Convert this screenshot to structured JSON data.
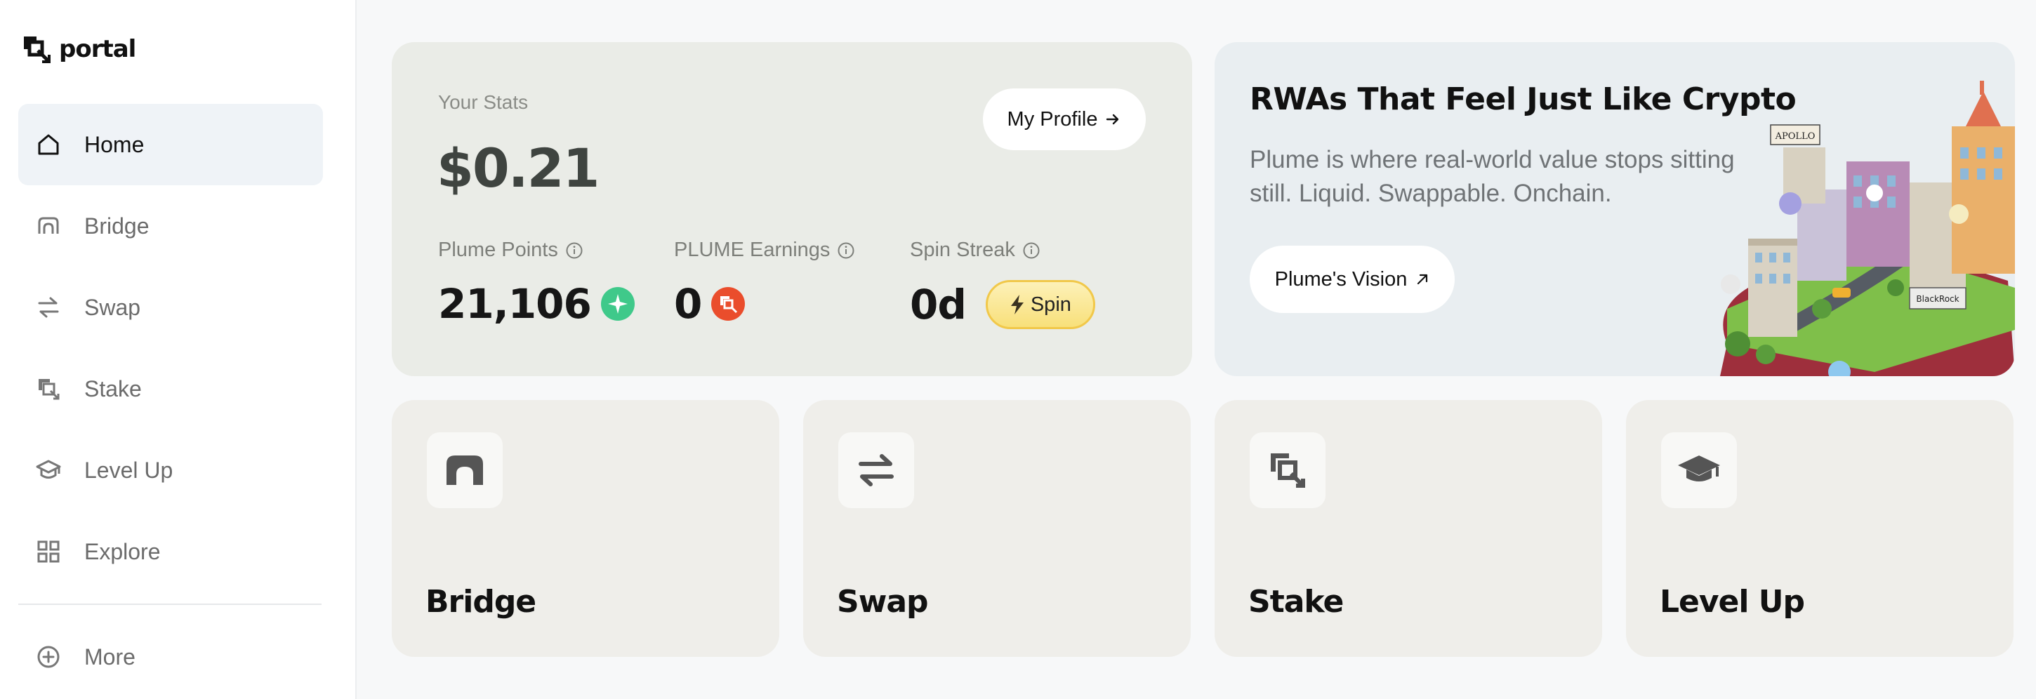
{
  "app": {
    "logo_text": "portal"
  },
  "sidebar": {
    "items": [
      {
        "label": "Home",
        "icon": "home-icon",
        "active": true
      },
      {
        "label": "Bridge",
        "icon": "bridge-icon"
      },
      {
        "label": "Swap",
        "icon": "swap-icon"
      },
      {
        "label": "Stake",
        "icon": "stake-icon"
      },
      {
        "label": "Level Up",
        "icon": "graduation-cap-icon"
      },
      {
        "label": "Explore",
        "icon": "grid-icon"
      }
    ],
    "more_label": "More"
  },
  "stats": {
    "title": "Your Stats",
    "total": "$0.21",
    "profile_button": "My Profile",
    "points_label": "Plume Points",
    "points_value": "21,106",
    "earnings_label": "PLUME Earnings",
    "earnings_value": "0",
    "streak_label": "Spin Streak",
    "streak_value": "0d",
    "spin_button": "Spin"
  },
  "promo": {
    "title": "RWAs That Feel Just Like Crypto",
    "description": "Plume is where real-world value stops sitting still. Liquid. Swappable. Onchain.",
    "button": "Plume's Vision",
    "sign_apollo": "APOLLO",
    "sign_blackrock": "BlackRock"
  },
  "actions": [
    {
      "label": "Bridge",
      "icon": "bridge-icon"
    },
    {
      "label": "Swap",
      "icon": "swap-icon"
    },
    {
      "label": "Stake",
      "icon": "stake-icon"
    },
    {
      "label": "Level Up",
      "icon": "graduation-cap-icon"
    }
  ],
  "colors": {
    "points_badge": "#3fc98a",
    "earnings_badge": "#ea4d2c",
    "spin_accent": "#f1c84a",
    "active_nav_bg": "#eff3f7"
  }
}
